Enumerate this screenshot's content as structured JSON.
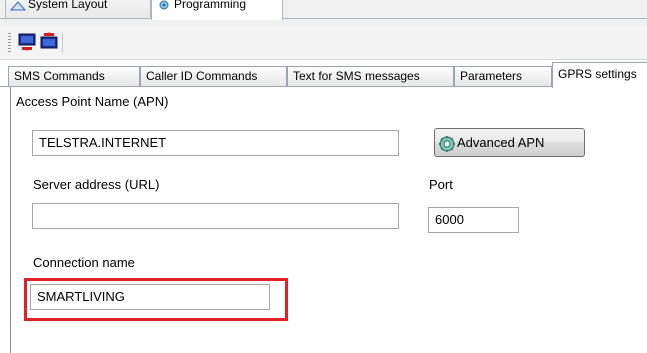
{
  "top_tabs": [
    {
      "label": "System Layout"
    },
    {
      "label": "Programming"
    }
  ],
  "sub_tabs": [
    {
      "label": "SMS Commands"
    },
    {
      "label": "Caller ID Commands"
    },
    {
      "label": "Text for SMS messages"
    },
    {
      "label": "Parameters"
    },
    {
      "label": "GPRS settings"
    }
  ],
  "form": {
    "apn_label": "Access Point Name (APN)",
    "apn_value": "TELSTRA.INTERNET",
    "advanced_apn_label": "Advanced APN",
    "server_label": "Server address (URL)",
    "server_value": "",
    "port_label": "Port",
    "port_value": "6000",
    "connection_label": "Connection name",
    "connection_value": "SMARTLIVING"
  },
  "colors": {
    "highlight": "#e2202a",
    "border": "#a6a6a6"
  }
}
